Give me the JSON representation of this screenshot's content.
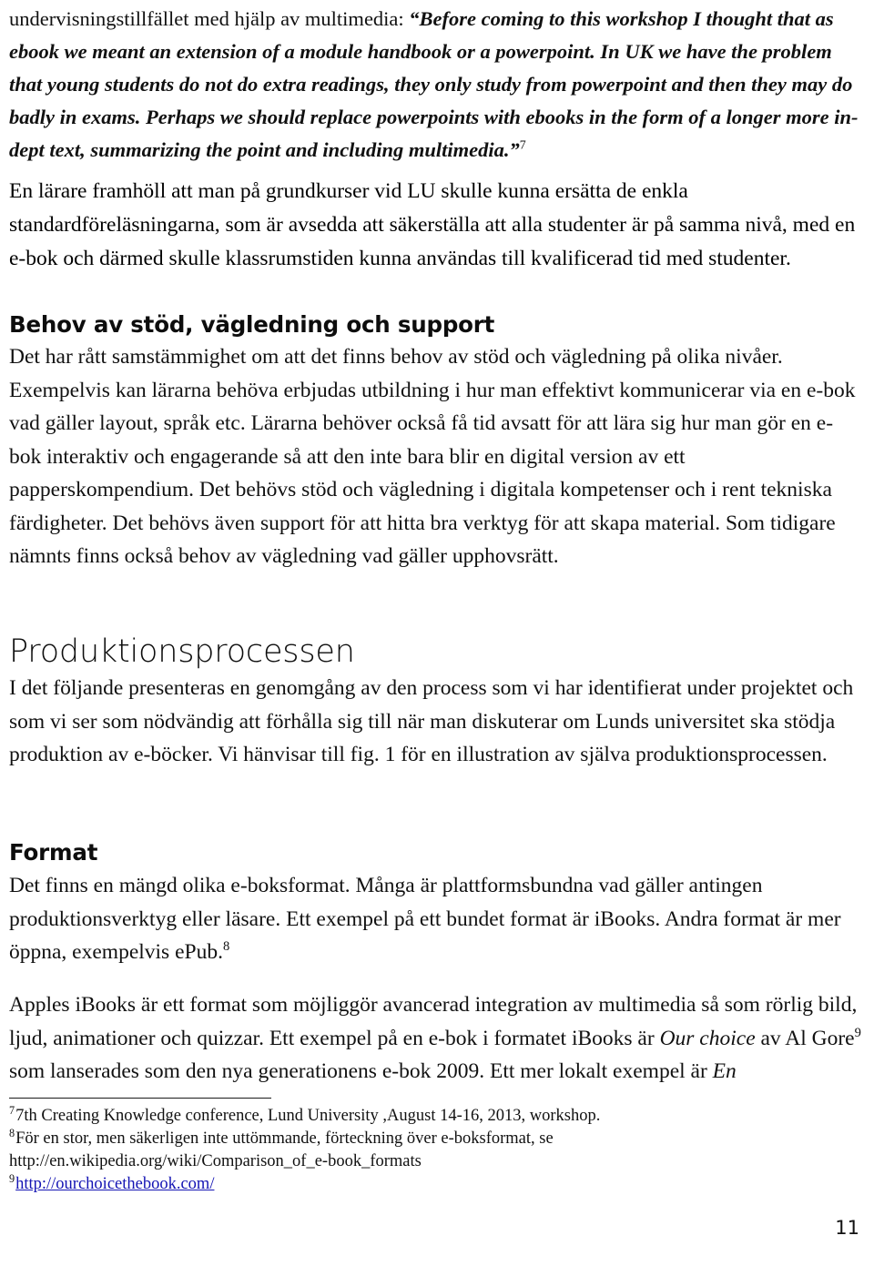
{
  "document": {
    "language": "sv",
    "page_number": "11"
  },
  "quote_paragraph": {
    "lead_in": "undervisningstillfället med hjälp av multimedia: ",
    "quoted_text": "“Before coming to this workshop I thought that as ebook we meant an extension of a module handbook or a powerpoint. In UK we have the problem that young students do not do extra readings, they only study from powerpoint and then they may do badly in exams. Perhaps we should replace powerpoints with ebooks in the form of a longer more in-dept text, summarizing the point and including multimedia.”",
    "footnote_marker": "7"
  },
  "teacher_paragraph": {
    "text": "En lärare framhöll att man på grundkurser vid LU skulle kunna ersätta de enkla standardföreläsningarna, som är avsedda att säkerställa att alla studenter är på samma nivå, med en e-bok och därmed skulle klassrumstiden kunna användas till kvalificerad tid med studenter."
  },
  "support_section": {
    "heading": "Behov av stöd, vägledning och support",
    "paragraph": "Det har rått samstämmighet om att det finns behov av stöd och vägledning på olika nivåer. Exempelvis kan lärarna behöva erbjudas utbildning i hur man effektivt kommunicerar via en e-bok vad gäller layout, språk etc. Lärarna behöver också få tid avsatt för att lära sig hur man gör en e-bok interaktiv och engagerande så att den inte bara blir en digital version av ett papperskompendium. Det behövs stöd och vägledning i digitala kompetenser och i rent tekniska färdigheter. Det behövs även support för att hitta bra verktyg för att skapa material. Som tidigare nämnts finns också behov av vägledning vad gäller upphovsrätt."
  },
  "production_section": {
    "heading": "Produktionsprocessen",
    "paragraph": "I det följande presenteras en genomgång av den process som vi har identifierat under projektet och som vi ser som nödvändig att förhålla sig till när man diskuterar om Lunds universitet ska stödja produktion av e-böcker. Vi hänvisar till fig. 1 för en illustration av själva produktionsprocessen."
  },
  "format_section": {
    "heading": "Format",
    "paragraph_part1": "Det finns en mängd olika e-boksformat. Många är plattformsbundna vad gäller antingen produktionsverktyg eller läsare. Ett exempel på ett bundet format är iBooks. Andra format är mer öppna, exempelvis ePub.",
    "footnote_marker": "8"
  },
  "ibooks_paragraph": {
    "part1": "Apples iBooks är ett format som möjliggör avancerad integration av multimedia så som rörlig bild, ljud, animationer och quizzar. Ett exempel på en e-bok i formatet iBooks är ",
    "italic1": "Our choice",
    "part2": " av Al Gore",
    "footnote_marker": "9",
    "part3": " som lanserades som den nya generationens e-bok 2009. Ett mer lokalt exempel är ",
    "italic2": "En"
  },
  "footnotes": [
    {
      "marker": "7",
      "text": "7th Creating Knowledge conference, Lund University ,August 14-16, 2013, workshop.",
      "is_link": false
    },
    {
      "marker": "8",
      "text": "För en stor, men säkerligen inte uttömmande, förteckning över e-boksformat, se",
      "continuation": "http://en.wikipedia.org/wiki/Comparison_of_e-book_formats",
      "is_link": false
    },
    {
      "marker": "9",
      "text": "http://ourchoicethebook.com/",
      "is_link": true
    }
  ],
  "colors": {
    "text": "#111111",
    "link": "#1414b4",
    "rule": "#1a1a1a",
    "background": "#ffffff"
  }
}
